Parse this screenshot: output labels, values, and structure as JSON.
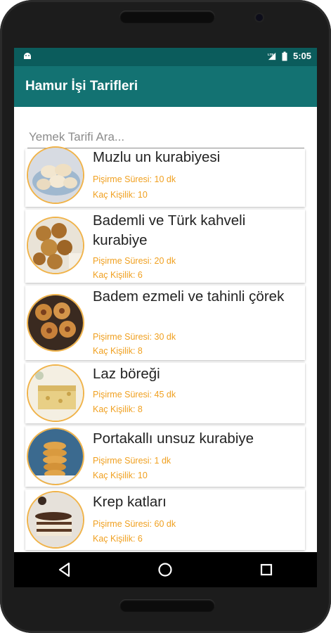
{
  "status": {
    "time": "5:05",
    "network": "LTE"
  },
  "app": {
    "title": "Hamur İşi Tarifleri",
    "primary_color": "#137272",
    "status_color": "#0b5c5c",
    "accent_color": "#f0a020"
  },
  "search": {
    "placeholder": "Yemek Tarifi Ara..."
  },
  "recipes": [
    {
      "title": "Muzlu un kurabiyesi",
      "time": "Pişirme Süresi: 10 dk",
      "servings": "Kaç Kişilik: 10"
    },
    {
      "title": "Bademli ve Türk kahveli kurabiye",
      "time": "Pişirme Süresi: 20 dk",
      "servings": "Kaç Kişilik: 6"
    },
    {
      "title": "Badem ezmeli ve tahinli çörek",
      "time": "Pişirme Süresi: 30 dk",
      "servings": "Kaç Kişilik: 8"
    },
    {
      "title": "Laz böreği",
      "time": "Pişirme Süresi: 45 dk",
      "servings": "Kaç Kişilik: 8"
    },
    {
      "title": "Portakallı unsuz kurabiye",
      "time": "Pişirme Süresi: 1 dk",
      "servings": "Kaç Kişilik: 10"
    },
    {
      "title": "Krep katları",
      "time": "Pişirme Süresi: 60 dk",
      "servings": "Kaç Kişilik: 6"
    }
  ],
  "navigation": {
    "back_icon": "back-triangle-icon",
    "home_icon": "home-circle-icon",
    "recents_icon": "recents-square-icon"
  }
}
